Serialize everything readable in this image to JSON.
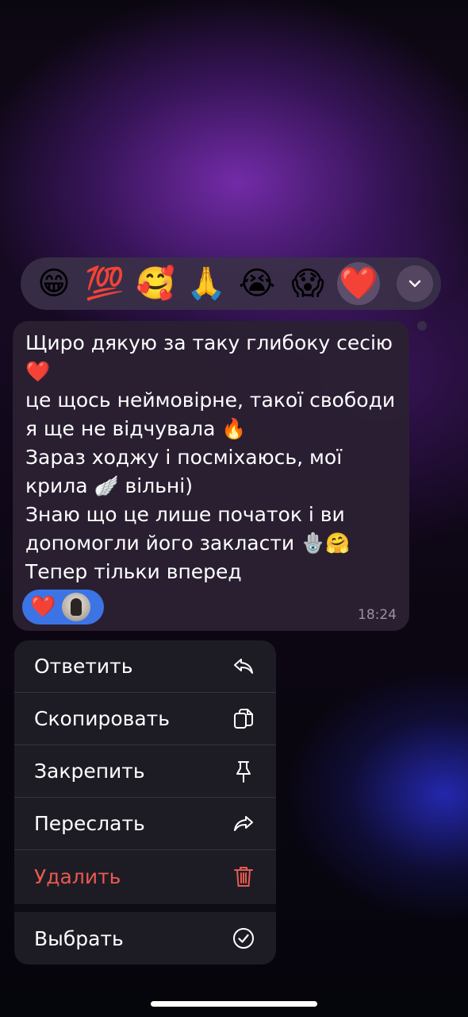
{
  "reactions": [
    {
      "emoji": "😁",
      "name": "grinning-face"
    },
    {
      "emoji": "💯",
      "name": "hundred-points"
    },
    {
      "emoji": "🥰",
      "name": "smiling-face-with-hearts"
    },
    {
      "emoji": "🙏",
      "name": "folded-hands"
    },
    {
      "emoji": "😭",
      "name": "loudly-crying-face"
    },
    {
      "emoji": "😱",
      "name": "screaming-face"
    },
    {
      "emoji": "❤️",
      "name": "red-heart",
      "selected": true
    }
  ],
  "expand_icon": "chevron-down-icon",
  "message": {
    "text": "Щиро дякую за таку глибоку сесію ❤️\nце щось неймовірне, такої свободи я ще не відчувала 🔥\nЗараз ходжу і посміхаюсь, мої крила 🪽 вільні)\nЗнаю що це лише початок і ви допомогли його закласти 🪬🤗\nТепер тільки вперед",
    "reaction_emoji": "❤️",
    "time": "18:24"
  },
  "menu": {
    "reply": {
      "label": "Ответить",
      "icon": "reply-icon"
    },
    "copy": {
      "label": "Скопировать",
      "icon": "copy-icon"
    },
    "pin": {
      "label": "Закрепить",
      "icon": "pin-icon"
    },
    "forward": {
      "label": "Переслать",
      "icon": "forward-icon"
    },
    "delete": {
      "label": "Удалить",
      "icon": "trash-icon"
    },
    "select": {
      "label": "Выбрать",
      "icon": "check-circle-icon"
    }
  },
  "colors": {
    "accent_blue": "#3c74e5",
    "danger": "#e9594f",
    "bubble": "#2b2032",
    "menu": "#1e1d26"
  }
}
